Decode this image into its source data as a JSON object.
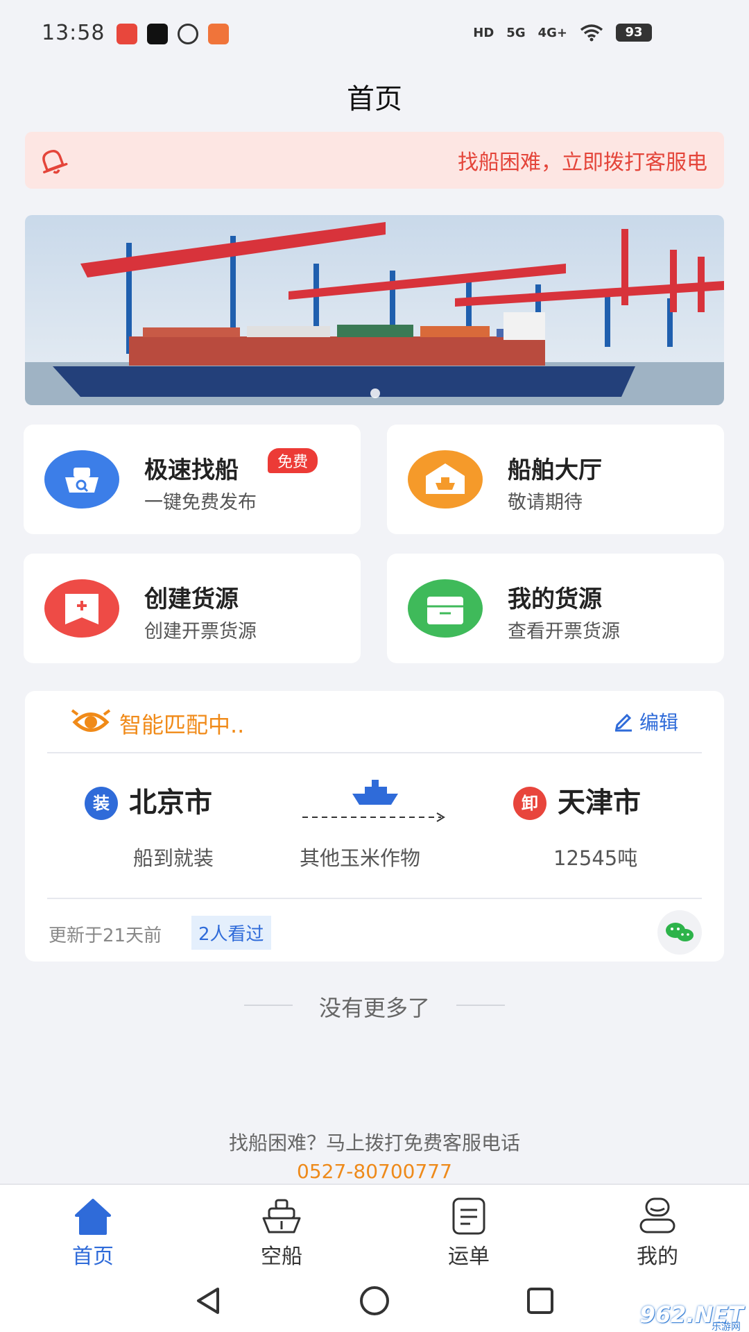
{
  "status_bar": {
    "time": "13:58",
    "hd": "HD",
    "signal_1": "5G",
    "signal_2": "4G+",
    "battery": "93"
  },
  "page": {
    "title": "首页"
  },
  "notice": {
    "icon": "bell-icon",
    "text": "找船困难，立即拨打客服电话"
  },
  "banner": {
    "slide_count": 1,
    "active_slide": 0
  },
  "cards": [
    {
      "title": "极速找船",
      "subtitle": "一键免费发布",
      "badge": "免费",
      "icon": "ship-search-icon",
      "color": "#3c7ee8"
    },
    {
      "title": "船舶大厅",
      "subtitle": "敬请期待",
      "icon": "ship-hall-icon",
      "color": "#f59a2a"
    },
    {
      "title": "创建货源",
      "subtitle": "创建开票货源",
      "icon": "create-cargo-icon",
      "color": "#ee4b46"
    },
    {
      "title": "我的货源",
      "subtitle": "查看开票货源",
      "icon": "cargo-box-icon",
      "color": "#3fba5a"
    }
  ],
  "match": {
    "status": "智能匹配中..",
    "edit_label": "编辑",
    "load_badge": "装",
    "unload_badge": "卸",
    "from_city": "北京市",
    "to_city": "天津市",
    "from_note": "船到就装",
    "cargo": "其他玉米作物",
    "weight": "12545吨",
    "updated": "更新于21天前",
    "views": "2人看过"
  },
  "footer": {
    "no_more": "没有更多了",
    "hotline_text": "找船困难？马上拨打免费客服电话",
    "hotline_phone": "0527-80700777"
  },
  "tabs": [
    {
      "label": "首页",
      "icon": "home-icon",
      "active": true
    },
    {
      "label": "空船",
      "icon": "empty-ship-icon",
      "active": false
    },
    {
      "label": "运单",
      "icon": "waybill-icon",
      "active": false
    },
    {
      "label": "我的",
      "icon": "profile-icon",
      "active": false
    }
  ],
  "watermark": {
    "brand": "962.NET",
    "sub": "乐游网"
  },
  "colors": {
    "accent": "#2f6bd9",
    "alert": "#e4453a",
    "orange": "#f08a18",
    "background": "#f2f3f7"
  }
}
